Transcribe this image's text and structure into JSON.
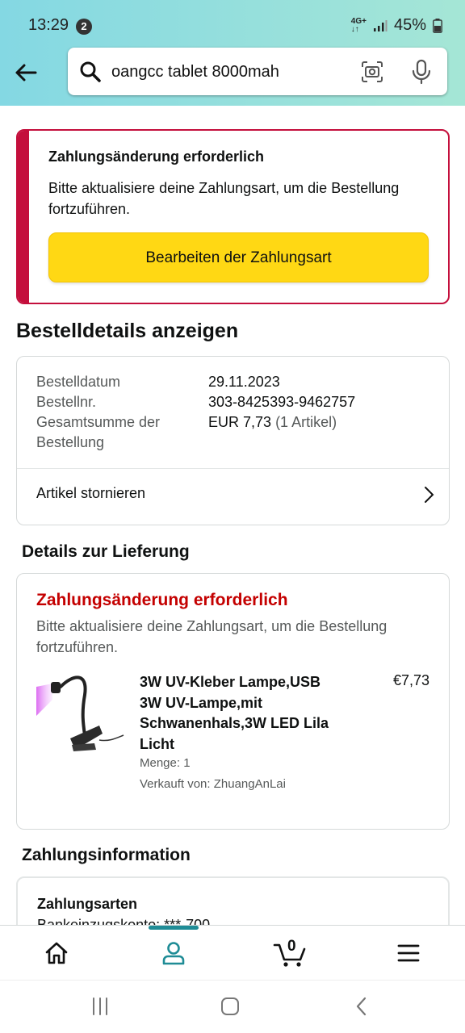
{
  "status": {
    "time": "13:29",
    "notif_count": "2",
    "net": "4G+",
    "battery": "45%"
  },
  "search": {
    "query": "oangcc tablet 8000mah"
  },
  "alert": {
    "title": "Zahlungsänderung erforderlich",
    "body": "Bitte aktualisiere deine Zahlungsart, um die Bestellung fortzuführen.",
    "button": "Bearbeiten der Zahlungsart"
  },
  "order": {
    "heading": "Bestelldetails anzeigen",
    "date_label": "Bestelldatum",
    "date_value": "29.11.2023",
    "number_label": "Bestellnr.",
    "number_value": "303-8425393-9462757",
    "total_label": "Gesamtsumme der Bestellung",
    "total_value": "EUR 7,73",
    "total_items": "(1 Artikel)",
    "cancel_label": "Artikel stornieren"
  },
  "delivery": {
    "heading": "Details zur Lieferung",
    "status_title": "Zahlungsänderung erforderlich",
    "status_body": "Bitte aktualisiere deine Zahlungsart, um die Bestellung fortzuführen.",
    "product_name": "3W UV-Kleber Lampe,USB 3W UV-Lampe,mit Schwanenhals,3W LED Lila Licht",
    "price": "€7,73",
    "quantity": "Menge: 1",
    "seller": "Verkauft von: ZhuangAnLai"
  },
  "payment": {
    "heading": "Zahlungsinformation",
    "methods_label": "Zahlungsarten",
    "methods_value": "Bankeinzugskonto: ***-700"
  },
  "bottom_nav": {
    "cart_count": "0"
  },
  "colors": {
    "accent": "#ffd814",
    "alert": "#c40f3c",
    "error_text": "#c40000",
    "nav_indicator": "#1f8c96"
  }
}
